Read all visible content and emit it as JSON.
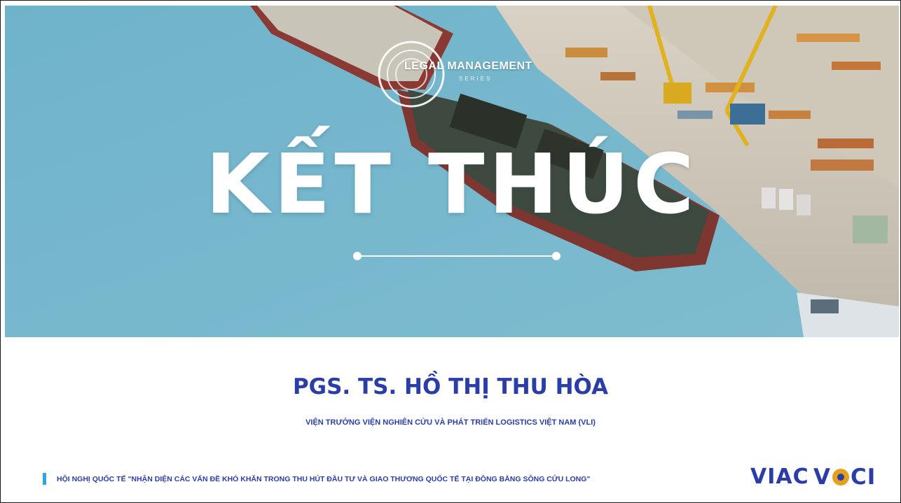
{
  "hero": {
    "brand_logo_text": "LEGAL MANAGEMENT",
    "brand_logo_sub": "SERIES",
    "title": "KẾT THÚC"
  },
  "presenter": {
    "name": "PGS. TS. HỒ THỊ THU HÒA",
    "role": "VIỆN TRƯỞNG VIỆN NGHIÊN CỨU VÀ PHÁT TRIỂN LOGISTICS VIỆT NAM (VLI)"
  },
  "footer": {
    "conference": "HỘI NGHỊ QUỐC TẾ \"NHẬN DIỆN CÁC VẤN ĐỀ KHÓ KHĂN TRONG THU HÚT ĐẦU TƯ VÀ GIAO THƯƠNG QUỐC TẾ TẠI ĐỒNG BẰNG SÔNG CỬU LONG\"",
    "logo_viac": "VIAC",
    "logo_vcci_v": "V",
    "logo_vcci_ci": "CI"
  },
  "colors": {
    "accent": "#2b3da6",
    "footer_marker": "#2fa8e0",
    "vcci_seal": "#e3a21a"
  }
}
